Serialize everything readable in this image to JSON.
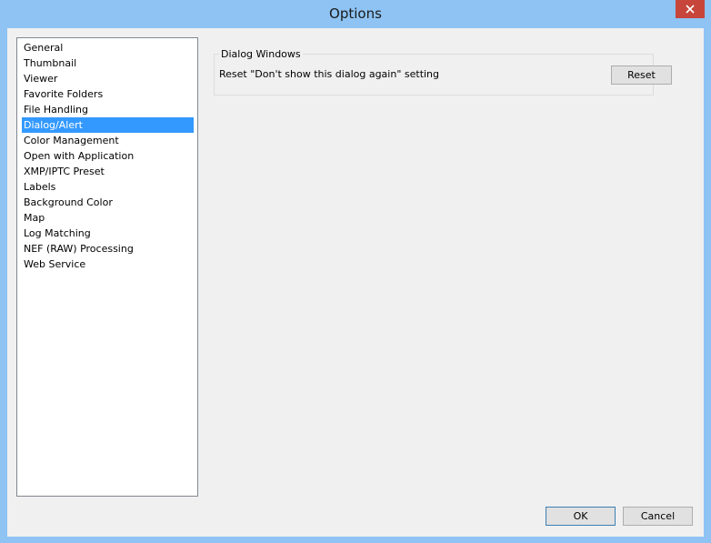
{
  "window": {
    "title": "Options"
  },
  "sidebar": {
    "items": [
      {
        "label": "General"
      },
      {
        "label": "Thumbnail"
      },
      {
        "label": "Viewer"
      },
      {
        "label": "Favorite Folders"
      },
      {
        "label": "File Handling"
      },
      {
        "label": "Dialog/Alert",
        "selected": true
      },
      {
        "label": "Color Management"
      },
      {
        "label": "Open with Application"
      },
      {
        "label": "XMP/IPTC Preset"
      },
      {
        "label": "Labels"
      },
      {
        "label": "Background Color"
      },
      {
        "label": "Map"
      },
      {
        "label": "Log Matching"
      },
      {
        "label": "NEF (RAW) Processing"
      },
      {
        "label": "Web Service"
      }
    ]
  },
  "dialog_windows": {
    "title": "Dialog Windows",
    "setting_text": "Reset \"Don't show this dialog again\" setting",
    "reset_label": "Reset"
  },
  "footer": {
    "ok_label": "OK",
    "cancel_label": "Cancel"
  },
  "icons": {
    "close": "close-icon"
  },
  "colors": {
    "selection": "#3399ff",
    "titlebar": "#8ec3f4",
    "close_button": "#c7453a"
  }
}
